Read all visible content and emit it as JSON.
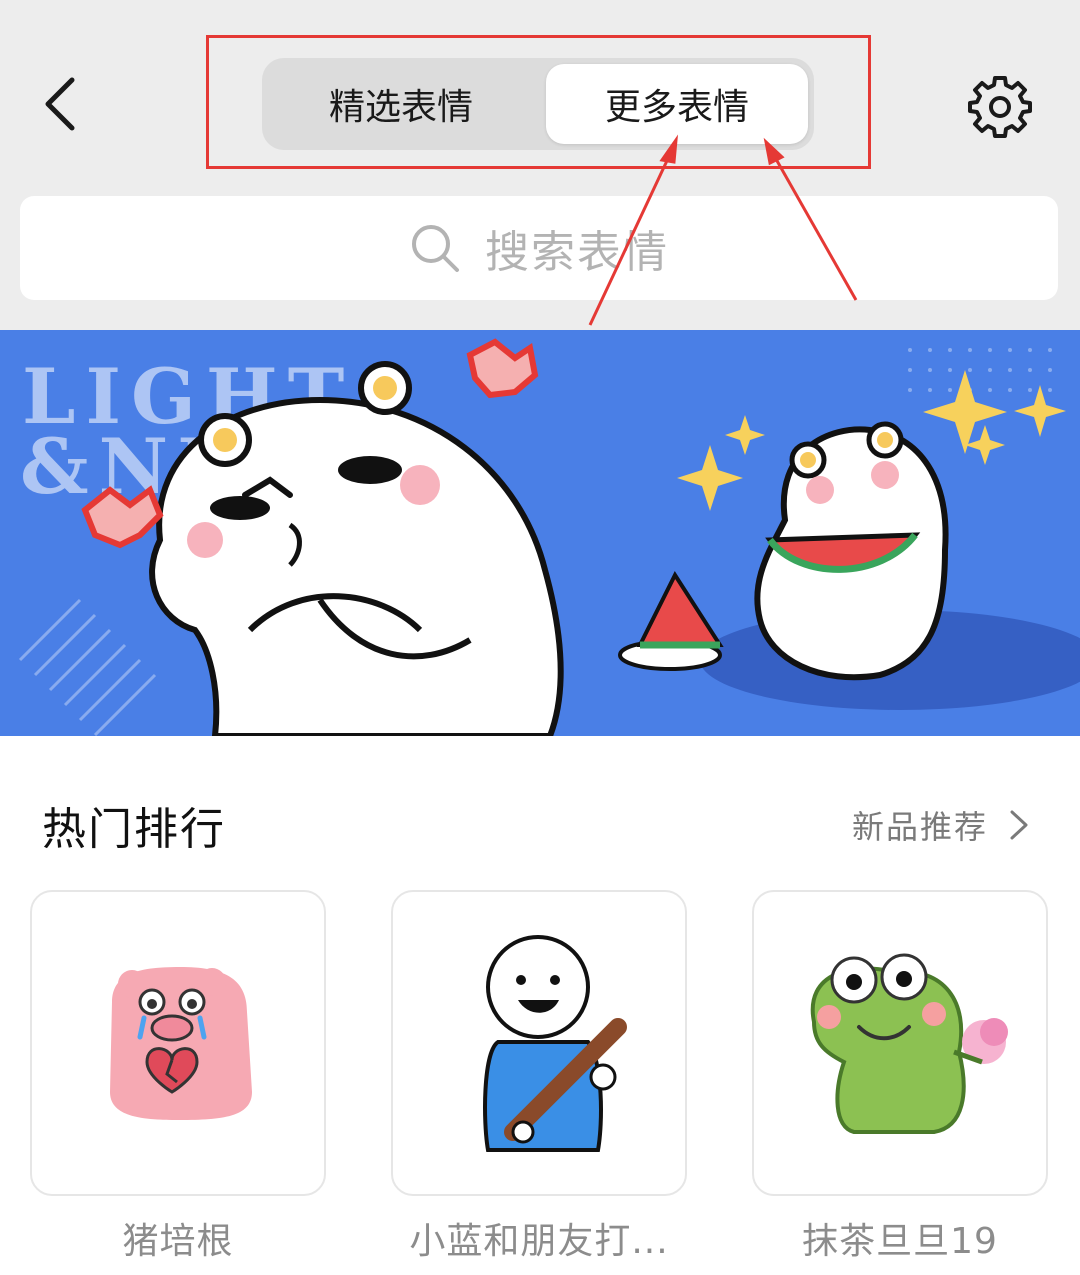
{
  "header": {
    "back_icon": "chevron-left-icon",
    "settings_icon": "gear-icon",
    "tabs": [
      {
        "label": "精选表情",
        "selected": false
      },
      {
        "label": "更多表情",
        "selected": true
      }
    ]
  },
  "search": {
    "icon": "search-icon",
    "placeholder": "搜索表情"
  },
  "banner": {
    "line1": "LIGHT",
    "line2": "&NU"
  },
  "section": {
    "title": "热门排行",
    "link_label": "新品推荐",
    "link_icon": "chevron-right-icon"
  },
  "stickers": [
    {
      "label": "猪培根",
      "icon": "pink-pig-sticker"
    },
    {
      "label": "小蓝和朋友打...",
      "icon": "stick-figure-bat-sticker"
    },
    {
      "label": "抹茶旦旦19",
      "icon": "green-dino-sticker"
    }
  ],
  "colors": {
    "highlight_border": "#e53935",
    "banner_bg": "#4a7fe6",
    "header_bg": "#ededed"
  }
}
